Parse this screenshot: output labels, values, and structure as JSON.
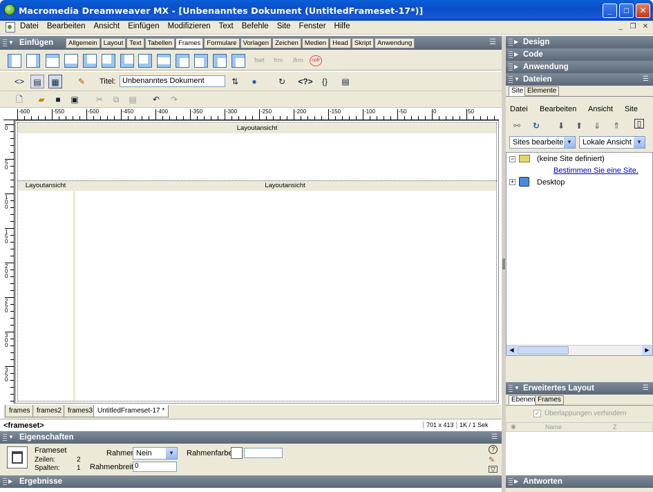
{
  "window": {
    "title": "Macromedia Dreamweaver MX - [Unbenanntes Dokument (UntitledFrameset-17*)]",
    "btn_min": "_",
    "btn_max": "□",
    "btn_close": "✕"
  },
  "menu": {
    "items": [
      "Datei",
      "Bearbeiten",
      "Ansicht",
      "Einfügen",
      "Modifizieren",
      "Text",
      "Befehle",
      "Site",
      "Fenster",
      "Hilfe"
    ],
    "mdi_min": "_",
    "mdi_restore": "❐",
    "mdi_close": "✕"
  },
  "insert_panel": {
    "title": "Einfügen",
    "tabs": [
      "Allgemein",
      "Layout",
      "Text",
      "Tabellen",
      "Frames",
      "Formulare",
      "Vorlagen",
      "Zeichen",
      "Medien",
      "Head",
      "Skript",
      "Anwendung"
    ],
    "active_tab": "Frames",
    "tag_buttons": [
      "fset",
      "frm",
      "ifrm",
      "nofr"
    ]
  },
  "doc_toolbar": {
    "title_label": "Titel:",
    "title_value": "Unbenanntes Dokument"
  },
  "ruler": {
    "h_labels": [
      "-600",
      "-550",
      "-500",
      "-450",
      "-400",
      "-350",
      "-300",
      "-250",
      "-200",
      "-150",
      "-100",
      "-50",
      "0",
      "50"
    ],
    "v_labels": [
      "0",
      "50",
      "100",
      "150",
      "200",
      "250",
      "300",
      "350"
    ]
  },
  "design": {
    "top_frame_label": "Layoutansicht",
    "left_frame_label": "Layoutansicht",
    "right_frame_label": "Layoutansicht"
  },
  "doc_tabs": [
    "frames",
    "frames2",
    "frames3",
    "UntitledFrameset-17 *"
  ],
  "status": {
    "tag": "<frameset>",
    "size": "701 x 413",
    "weight": "1K / 1 Sek"
  },
  "properties": {
    "title": "Eigenschaften",
    "type_label": "Frameset",
    "rows_label": "Zeilen:",
    "rows_value": "2",
    "cols_label": "Spalten:",
    "cols_value": "1",
    "border_label": "Rahmen",
    "border_value": "Nein",
    "border_color_label": "Rahmenfarbe",
    "border_width_label": "Rahmenbreite",
    "border_width_value": "0"
  },
  "results": {
    "title": "Ergebnisse"
  },
  "right_dock": {
    "design": "Design",
    "code": "Code",
    "application": "Anwendung",
    "files": "Dateien",
    "files_tabs": [
      "Site",
      "Elemente"
    ],
    "files_menu": [
      "Datei",
      "Bearbeiten",
      "Ansicht",
      "Site"
    ],
    "site_select": "Sites bearbeite",
    "view_select": "Lokale Ansicht",
    "tree_root": "(keine Site definiert)",
    "tree_link": "Bestimmen Sie eine Site.",
    "tree_desktop": "Desktop",
    "advanced_layout": "Erweitertes Layout",
    "advanced_tabs": [
      "Ebenen",
      "Frames"
    ],
    "prevent_overlap": "Überlappungen verhindern",
    "col_name": "Name",
    "col_z": "Z",
    "answers": "Antworten"
  },
  "colors": {
    "titlebar": "#0a5fd8",
    "panel_header": "#6b7888",
    "chrome": "#ece9d8",
    "link": "#0000cc"
  }
}
